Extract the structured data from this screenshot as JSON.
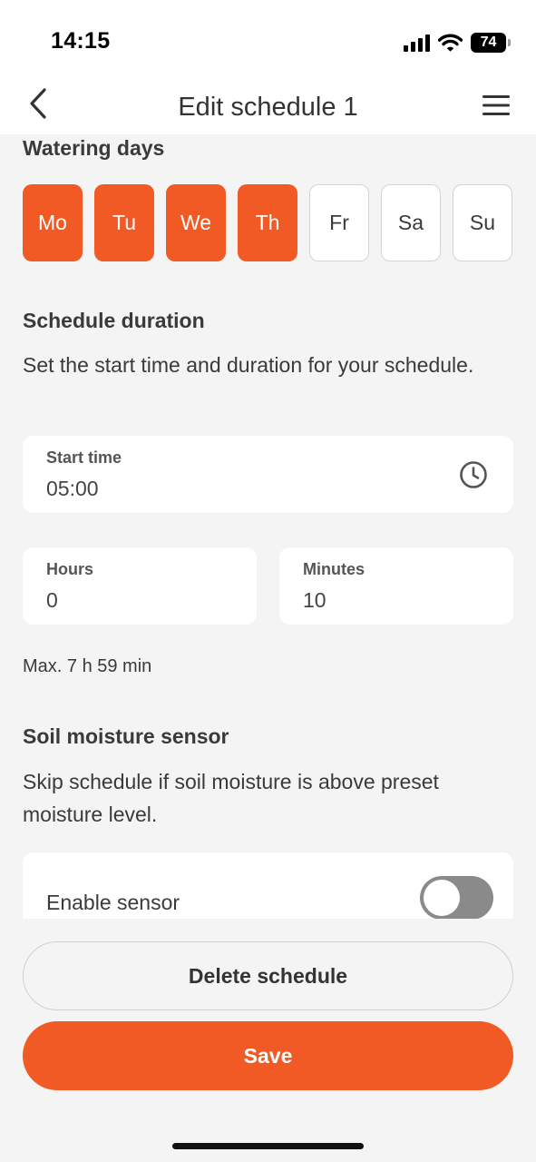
{
  "status_bar": {
    "time": "14:15",
    "battery_level": "74",
    "icons": [
      "cellular-signal-icon",
      "wifi-icon",
      "battery-icon"
    ]
  },
  "header": {
    "title": "Edit schedule 1",
    "back_icon": "chevron-left-icon",
    "menu_icon": "hamburger-menu-icon"
  },
  "watering_days": {
    "title": "Watering days",
    "days": [
      {
        "label": "Mo",
        "selected": true
      },
      {
        "label": "Tu",
        "selected": true
      },
      {
        "label": "We",
        "selected": true
      },
      {
        "label": "Th",
        "selected": true
      },
      {
        "label": "Fr",
        "selected": false
      },
      {
        "label": "Sa",
        "selected": false
      },
      {
        "label": "Su",
        "selected": false
      }
    ]
  },
  "schedule_duration": {
    "title": "Schedule duration",
    "description": "Set the start time and duration for your schedule.",
    "start_time": {
      "label": "Start time",
      "value": "05:00",
      "icon": "clock-icon"
    },
    "hours": {
      "label": "Hours",
      "value": "0"
    },
    "minutes": {
      "label": "Minutes",
      "value": "10"
    },
    "max_note": "Max. 7 h 59 min"
  },
  "soil_moisture": {
    "title": "Soil moisture sensor",
    "description": "Skip schedule if soil moisture is above preset moisture level.",
    "enable_label": "Enable sensor",
    "enabled": false
  },
  "actions": {
    "delete_label": "Delete schedule",
    "save_label": "Save"
  },
  "colors": {
    "accent": "#f15a24",
    "background": "#f4f4f4",
    "card": "#ffffff",
    "toggle_off": "#8a8a8a"
  }
}
